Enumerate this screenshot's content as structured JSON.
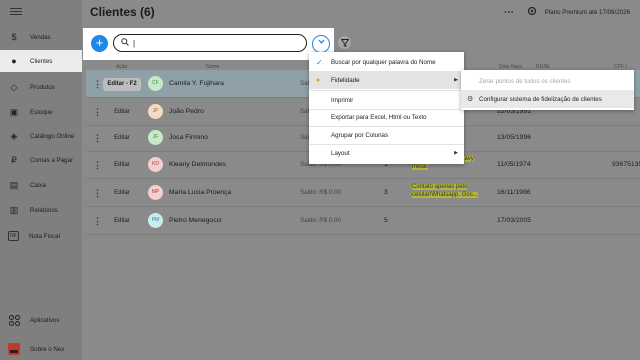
{
  "header": {
    "title": "Clientes (6)",
    "more_icon": "⋯",
    "plan_label": "Plano Premium até 17/06/2026"
  },
  "sidebar": {
    "items": [
      {
        "label": "Vendas",
        "icon": "$"
      },
      {
        "label": "Clientes",
        "icon": "●"
      },
      {
        "label": "Produtos",
        "icon": "◇"
      },
      {
        "label": "Estoque",
        "icon": "▣"
      },
      {
        "label": "Catálogo Online",
        "icon": "◈"
      },
      {
        "label": "Contas a Pagar",
        "icon": "₽"
      },
      {
        "label": "Caixa",
        "icon": "▤"
      },
      {
        "label": "Relatórios",
        "icon": "▥"
      },
      {
        "label": "Nota Fiscal",
        "icon": "NF"
      }
    ],
    "apps_label": "Aplicativos",
    "about_label": "Sobre o Nex"
  },
  "search": {
    "value": "|",
    "add_label": "+"
  },
  "table": {
    "headers": [
      "Ação",
      "Nome",
      "Data Nasc.",
      "RG/IE",
      "CPF / CNPJ"
    ],
    "rows": [
      {
        "action": "Editar - F2",
        "initials": "CF",
        "name": "Camila Y. Fujihara",
        "saldo": "Saldo: R$ 0,00",
        "count": "",
        "obs": "",
        "date": "",
        "cpf": "",
        "av_bg": "#c7e9c9",
        "av_fg": "#3f8d45"
      },
      {
        "action": "Editar",
        "initials": "JP",
        "name": "João Pedro",
        "saldo": "Saldo",
        "count": "",
        "obs": "",
        "date": "22/03/1991",
        "cpf": "",
        "av_bg": "#f1dcc0",
        "av_fg": "#a4672a"
      },
      {
        "action": "Editar",
        "initials": "JF",
        "name": "Joca Firmino",
        "saldo": "Saldo",
        "count": "",
        "obs": "",
        "date": "13/05/1996",
        "cpf": "",
        "av_bg": "#c7e9c9",
        "av_fg": "#3f8d45"
      },
      {
        "action": "Editar",
        "initials": "KD",
        "name": "Kleany Delmondes",
        "saldo": "Saldo: R$ 0,00",
        "count": "1",
        "obs": "Prefere bolos de heavy metal.",
        "date": "11/05/1974",
        "cpf": "93675135",
        "av_bg": "#f3cfd0",
        "av_fg": "#a84447"
      },
      {
        "action": "Editar",
        "initials": "MP",
        "name": "Maria Lucia Proença",
        "saldo": "Saldo: R$ 0,00",
        "count": "3",
        "obs": "Contato apenas pelo celular/Whatsapp. Gos...",
        "date": "16/11/1986",
        "cpf": "",
        "av_bg": "#f3cfd0",
        "av_fg": "#a84447"
      },
      {
        "action": "Editar",
        "initials": "PM",
        "name": "Pietro Menegocci",
        "saldo": "Saldo: R$ 0,00",
        "count": "5",
        "obs": "",
        "date": "17/03/2005",
        "cpf": "",
        "av_bg": "#c9ecee",
        "av_fg": "#2f8a90"
      }
    ]
  },
  "menu": {
    "items": [
      {
        "label": "Buscar por qualquer palavra do Nome",
        "checked": true
      },
      {
        "label": "Fidelidade",
        "submenu": true
      },
      {
        "label": "Imprimir"
      },
      {
        "label": "Exportar para Excel, Html ou Texto"
      },
      {
        "label": "Agrupar por Colunas"
      },
      {
        "label": "Layout",
        "submenu": true
      }
    ]
  },
  "submenu": {
    "items": [
      {
        "label": "Zerar pontos de todos os clientes",
        "disabled": true
      },
      {
        "label": "Configurar sistema de fidelização de clientes"
      }
    ]
  },
  "colors": {
    "accent": "#1e88e5",
    "highlight": "#b5b340"
  }
}
